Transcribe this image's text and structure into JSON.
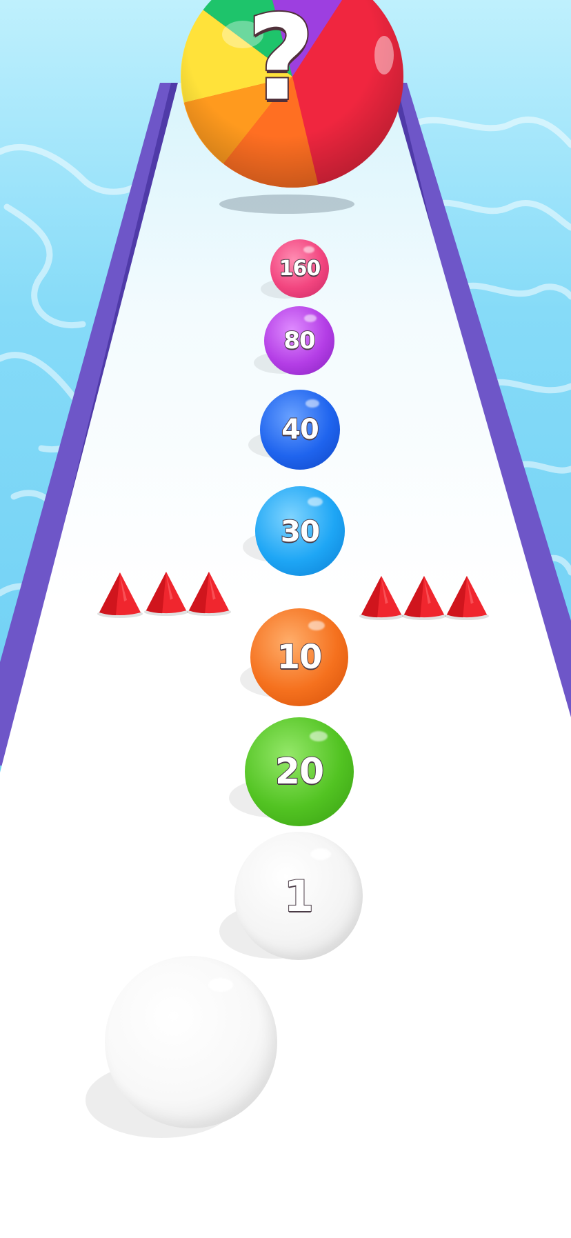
{
  "game": {
    "mystery_ball": {
      "label": "?",
      "icon": "question-mark-icon"
    },
    "balls": [
      {
        "label": "160",
        "color": "#f2457f"
      },
      {
        "label": "80",
        "color": "#b43ee6"
      },
      {
        "label": "40",
        "color": "#1f64ee"
      },
      {
        "label": "30",
        "color": "#1ea6f5"
      },
      {
        "label": "10",
        "color": "#f5711e"
      },
      {
        "label": "20",
        "color": "#52c322"
      },
      {
        "label": "1",
        "color": "#f4f4f4"
      }
    ],
    "player_ball": {
      "label": "",
      "color": "#f8f8f8"
    },
    "spikes": {
      "left_count": 3,
      "right_count": 3,
      "color": "#f0262e"
    }
  },
  "colors": {
    "water": "#6ccff5",
    "water_light": "#a8e6fb",
    "track": "#ffffff",
    "rail": "#6a55c4"
  }
}
